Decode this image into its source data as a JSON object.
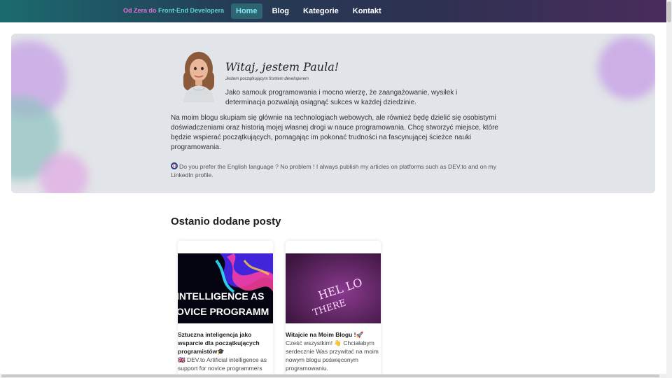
{
  "nav": {
    "brand_part1": "Od Zera do ",
    "brand_part2": "Front-End Developera",
    "links": [
      {
        "label": "Home",
        "active": true
      },
      {
        "label": "Blog",
        "active": false
      },
      {
        "label": "Kategorie",
        "active": false
      },
      {
        "label": "Kontakt",
        "active": false
      }
    ]
  },
  "hero": {
    "title": "Witaj, jestem Paula!",
    "subtitle": "Jestem początkującym frontem developerem",
    "quote": "Jako samouk programowania i mocno wierzę, że zaangażowanie, wysiłek i determinacja pozwalają osiągnąć sukces w każdej dziedzinie.",
    "paragraph": "Na moim blogu skupiam się głównie na technologiach webowych, ale również będę dzielić się osobistymi doświadczeniami oraz historią mojej własnej drogi w nauce programowania. Chcę stworzyć miejsce, które będzie wspierać początkujących, pomagając im pokonać trudności na fascynującej ścieżce nauki programowania.",
    "english_note": "Do you prefer the English language ? No problem ! I always publish my articles on platforms such as DEV.to and on my LinkedIn profile."
  },
  "posts": {
    "section_title": "Ostanio dodane posty",
    "items": [
      {
        "image_text_line1": "INTELLIGENCE AS",
        "image_text_line2": "OVICE PROGRAMM",
        "title": "Sztuczna inteligencja jako wsparcie dla początkujących programistów🎓",
        "excerpt": "🇬🇧 DEV.to Artificial intelligence as support for novice programmers"
      },
      {
        "image_text_line1": "HEL LO",
        "image_text_line2": "THERE",
        "title": "Witajcie na Moim Blogu !🚀",
        "excerpt": "Cześć wszystkim! 👋 Chciałabym serdecznie Was przywitać na moim nowym blogu poświęconym programowaniu."
      }
    ]
  },
  "colors": {
    "accent_pink": "#e16fd6",
    "accent_teal": "#5fd4c9",
    "hero_bg": "#e1e4e8"
  }
}
